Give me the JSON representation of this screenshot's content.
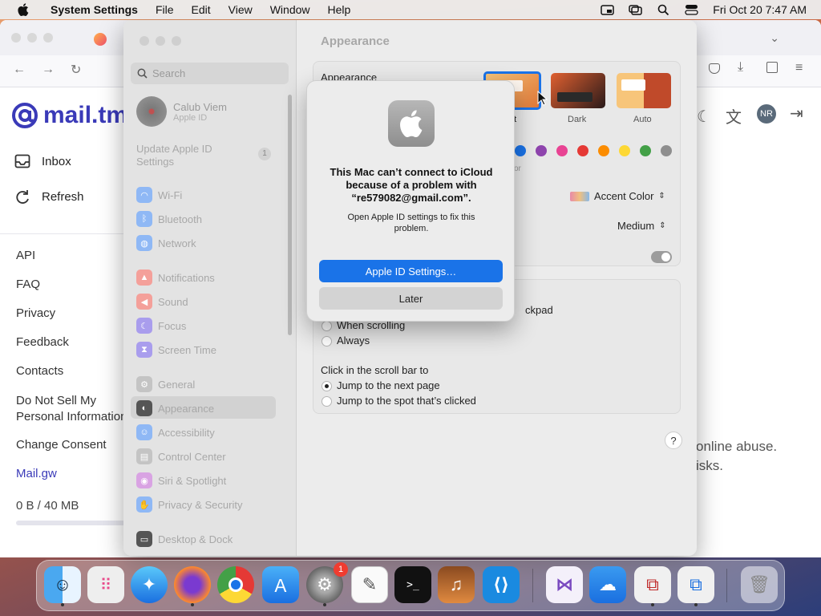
{
  "menubar": {
    "app_name": "System Settings",
    "menus": [
      "File",
      "Edit",
      "View",
      "Window",
      "Help"
    ],
    "clock": "Fri Oct 20  7:47 AM"
  },
  "browser": {
    "brand": "mail.tm",
    "nav": [
      {
        "label": "Inbox",
        "icon": "inbox-icon"
      },
      {
        "label": "Refresh",
        "icon": "refresh-icon"
      }
    ],
    "links": [
      "API",
      "FAQ",
      "Privacy",
      "Feedback",
      "Contacts",
      "Do Not Sell My Personal Information",
      "Change Consent",
      "Mail.gw"
    ],
    "storage": "0 B / 40 MB",
    "avatar": "NR",
    "right_text_1": "online abuse.",
    "right_text_2": "isks."
  },
  "settings": {
    "search_placeholder": "Search",
    "user": {
      "name": "Calub Viem",
      "sub": "Apple ID"
    },
    "update_item": {
      "label": "Update Apple ID Settings",
      "badge": "1"
    },
    "sidebar": [
      {
        "label": "Wi-Fi",
        "color": "#3d8ef5"
      },
      {
        "label": "Bluetooth",
        "color": "#3d8ef5"
      },
      {
        "label": "Network",
        "color": "#3d8ef5"
      },
      {
        "label": "Notifications",
        "color": "#f05a4f"
      },
      {
        "label": "Sound",
        "color": "#f05a4f"
      },
      {
        "label": "Focus",
        "color": "#6a5ae0"
      },
      {
        "label": "Screen Time",
        "color": "#6a5ae0"
      },
      {
        "label": "General",
        "color": "#9a9a9a"
      },
      {
        "label": "Appearance",
        "color": "#222222"
      },
      {
        "label": "Accessibility",
        "color": "#3d8ef5"
      },
      {
        "label": "Control Center",
        "color": "#9a9a9a"
      },
      {
        "label": "Siri & Spotlight",
        "color": "#c060d0"
      },
      {
        "label": "Privacy & Security",
        "color": "#3d8ef5"
      },
      {
        "label": "Desktop & Dock",
        "color": "#222222"
      }
    ],
    "content": {
      "title": "Appearance",
      "appearance_label": "Appearance",
      "themes": [
        "Light",
        "Dark",
        "Auto"
      ],
      "theme_light_visible": "ht",
      "accent_color_label": "Accent Color",
      "accent_sub": "or",
      "accent_colors": [
        "#1a73e8",
        "#8e44ad",
        "#e84393",
        "#e53935",
        "#fb8c00",
        "#fdd835",
        "#43a047",
        "#8e8e8e"
      ],
      "highlight_value": "Medium",
      "scroll_heading_tail": "ckpad",
      "show_scroll_options": [
        "When scrolling",
        "Always"
      ],
      "click_scroll_label": "Click in the scroll bar to",
      "click_scroll_options": [
        "Jump to the next page",
        "Jump to the spot that’s clicked"
      ],
      "help": "?"
    }
  },
  "dialog": {
    "title": "This Mac can’t connect to iCloud because of a problem with “re579082@gmail.com”.",
    "message": "Open Apple ID settings to fix this problem.",
    "primary": "Apple ID Settings…",
    "secondary": "Later"
  },
  "dock": {
    "apps": [
      "Finder",
      "Launchpad",
      "Safari",
      "Firefox",
      "Chrome",
      "App Store",
      "System Settings",
      "TextEdit",
      "Terminal",
      "GarageBand",
      "VS Code",
      "Visual Studio",
      "Weather",
      "Remote Desktop",
      "Remote Desktop 2",
      "Trash"
    ],
    "settings_badge": "1"
  }
}
